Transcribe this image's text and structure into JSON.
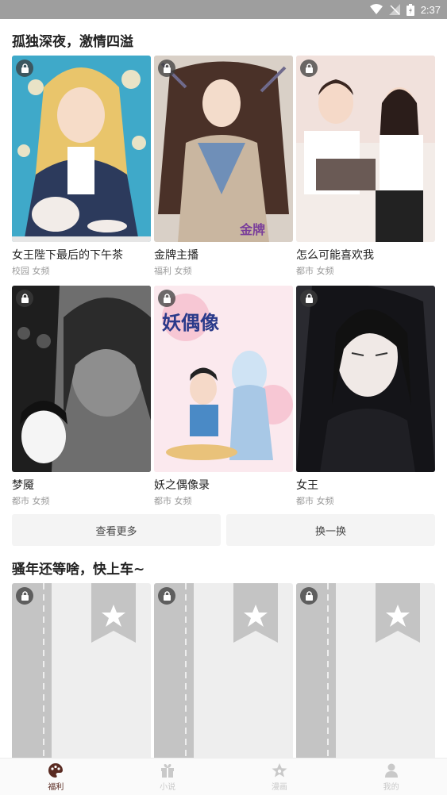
{
  "status_bar": {
    "time": "2:37"
  },
  "section1": {
    "title": "孤独深夜，激情四溢",
    "cards": [
      {
        "title": "女王陛下最后的下午茶",
        "tags": "校园 女频",
        "locked": true
      },
      {
        "title": "金牌主播",
        "tags": "福利 女频",
        "locked": true
      },
      {
        "title": "怎么可能喜欢我",
        "tags": "都市 女频",
        "locked": true
      },
      {
        "title": "梦魇",
        "tags": "都市 女频",
        "locked": true
      },
      {
        "title": "妖之偶像录",
        "tags": "都市 女频",
        "locked": true
      },
      {
        "title": "女王",
        "tags": "都市 女频",
        "locked": true
      }
    ],
    "more_label": "查看更多",
    "refresh_label": "换一换"
  },
  "section2": {
    "title": "骚年还等啥，快上车~"
  },
  "nav": {
    "items": [
      {
        "label": "福利",
        "icon": "palette-icon",
        "active": true
      },
      {
        "label": "小说",
        "icon": "gift-icon",
        "active": false
      },
      {
        "label": "漫画",
        "icon": "star-icon",
        "active": false
      },
      {
        "label": "我的",
        "icon": "person-icon",
        "active": false
      }
    ]
  },
  "colors": {
    "active_nav": "#5a2b22",
    "inactive_nav": "#c9c9c9",
    "status_bar": "#9e9e9e"
  }
}
